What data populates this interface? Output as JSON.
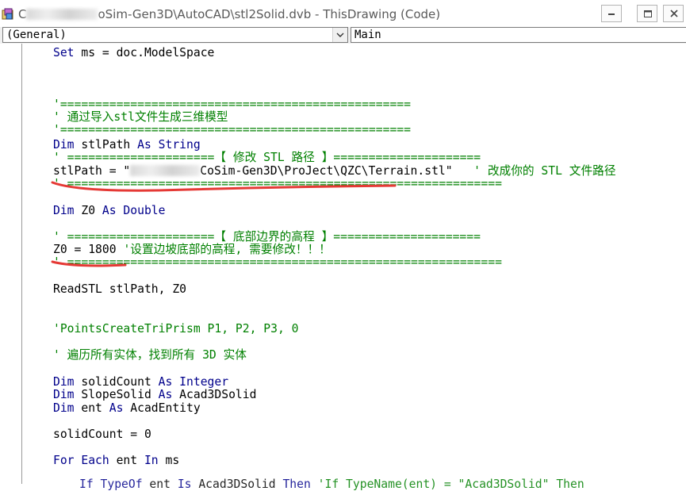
{
  "window": {
    "title_prefix": "C",
    "title_suffix": "oSim-Gen3D\\AutoCAD\\stl2Solid.dvb - ThisDrawing (Code)",
    "app_icon": "vba-editor-icon",
    "controls": [
      "minimize-icon",
      "maximize-icon",
      "close-icon"
    ]
  },
  "toolbar": {
    "object_combo": "(General)",
    "procedure_combo": "Main"
  },
  "code": {
    "l1_kw": "Set",
    "l1_rest": " ms = doc.ModelSpace",
    "l2": "'==================================================",
    "l3": "' 通过导入stl文件生成三维模型",
    "l4": "'==================================================",
    "l5_kw1": "Dim",
    "l5_mid": " stlPath ",
    "l5_kw2": "As String",
    "l6": "' =====================【 修改 STL 路径 】=====================",
    "l7_a": "stlPath = \"",
    "l7_b": "CoSim-Gen3D\\ProJect\\QZC\\Terrain.stl\"   ",
    "l7_cm": "' 改成你的 STL 文件路径",
    "l8": "' ==============================================================",
    "l9_kw1": "Dim",
    "l9_mid": " Z0 ",
    "l9_kw2": "As Double",
    "l10": "' =====================【 底部边界的高程 】=====================",
    "l11_a": "Z0 = 1800 ",
    "l11_cm": "'设置边坡底部的高程, 需要修改！！！",
    "l12": "' ==============================================================",
    "l13": "ReadSTL stlPath, Z0",
    "l14": "'PointsCreateTriPrism P1, P2, P3, 0",
    "l15": "' 遍历所有实体，找到所有 3D 实体",
    "l16_kw1": "Dim",
    "l16_mid": " solidCount ",
    "l16_kw2": "As Integer",
    "l17_kw1": "Dim",
    "l17_mid": " SlopeSolid ",
    "l17_kw2": "As",
    "l17_rest": " Acad3DSolid",
    "l18_kw1": "Dim",
    "l18_mid": " ent ",
    "l18_kw2": "As",
    "l18_rest": " AcadEntity",
    "l19": "solidCount = 0",
    "l20_kw1": "For Each",
    "l20_mid": " ent ",
    "l20_kw2": "In",
    "l20_rest": " ms",
    "l21_kw1": "If TypeOf",
    "l21_mid": " ent ",
    "l21_kw2": "Is",
    "l21_rest": " Acad3DSolid ",
    "l21_kw3": "Then",
    "l21_cm": " 'If TypeName(ent) = \"Acad3DSolid\" Then"
  },
  "colors": {
    "keyword": "#00008b",
    "comment": "#008000",
    "annotation": "#e53935"
  }
}
